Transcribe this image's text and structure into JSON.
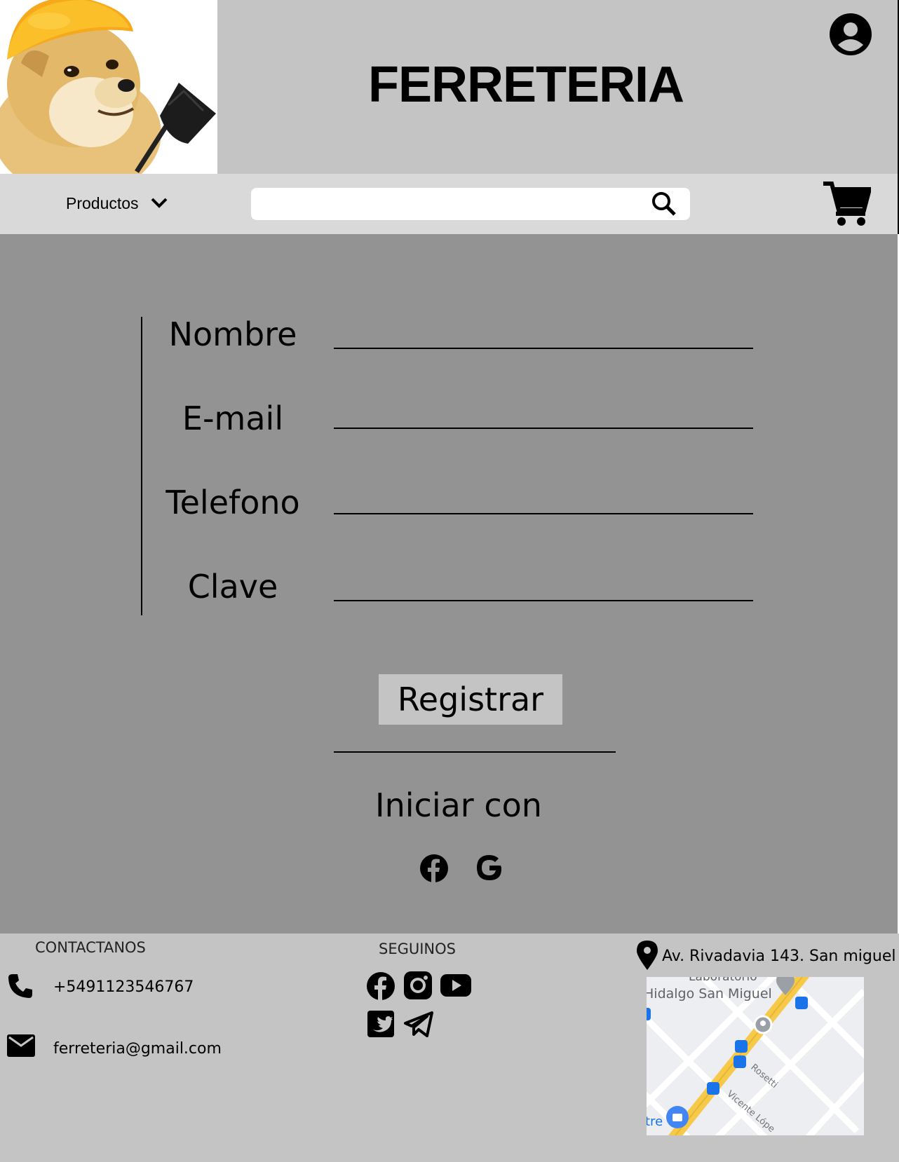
{
  "header": {
    "title": "FERRETERIA",
    "logo_icon": "doge-with-hardhat-and-shovel",
    "account_icon": "user-circle-icon"
  },
  "nav": {
    "products_label": "Productos",
    "search_placeholder": "",
    "search_icon": "magnifier",
    "cart_icon": "shopping-cart"
  },
  "form": {
    "fields": [
      {
        "label": "Nombre",
        "value": ""
      },
      {
        "label": "E-mail",
        "value": ""
      },
      {
        "label": "Telefono",
        "value": ""
      },
      {
        "label": "Clave",
        "value": ""
      }
    ],
    "register_label": "Registrar",
    "login_with_label": "Iniciar con",
    "providers": [
      "facebook-icon",
      "google-icon"
    ]
  },
  "footer": {
    "contact_heading": "CONTACTANOS",
    "phone": "+5491123546767",
    "email": "ferreteria@gmail.com",
    "follow_heading": "SEGUINOS",
    "social_icons": [
      "facebook-icon",
      "instagram-icon",
      "youtube-icon",
      "twitter-icon",
      "telegram-icon"
    ],
    "address": "Av. Rivadavia 143. San miguel",
    "map": {
      "labels": [
        "Laboratorio",
        "Hidalgo San Miguel",
        "Rosetti",
        "Vicente Lópe",
        "tre"
      ]
    }
  },
  "colors": {
    "header_bg": "#c4c4c4",
    "nav_bg": "#d9d9d9",
    "main_bg": "#939393",
    "footer_bg": "#c4c4c4",
    "button_bg": "#c4c4c4"
  }
}
